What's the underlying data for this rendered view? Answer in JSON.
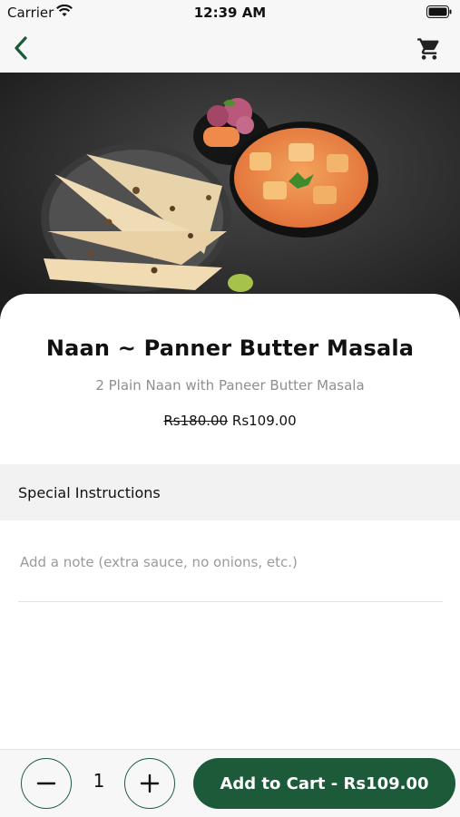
{
  "status_bar": {
    "carrier": "Carrier",
    "time": "12:39 AM"
  },
  "nav": {
    "back_icon": "chevron-left-icon",
    "cart_icon": "shopping-cart-icon"
  },
  "item": {
    "name": "Naan ~ Panner Butter Masala",
    "description": "2 Plain Naan with Paneer Butter Masala",
    "original_price": "Rs180.00",
    "price": "Rs109.00"
  },
  "instructions": {
    "label": "Special Instructions",
    "placeholder": "Add a note (extra sauce, no onions, etc.)",
    "value": ""
  },
  "cart": {
    "quantity": "1",
    "minus_icon": "minus-icon",
    "plus_icon": "plus-icon",
    "add_label": "Add to Cart - Rs109.00"
  },
  "colors": {
    "accent": "#1c5a3a",
    "background": "#ffffff",
    "section_bg": "#f2f2f2"
  }
}
